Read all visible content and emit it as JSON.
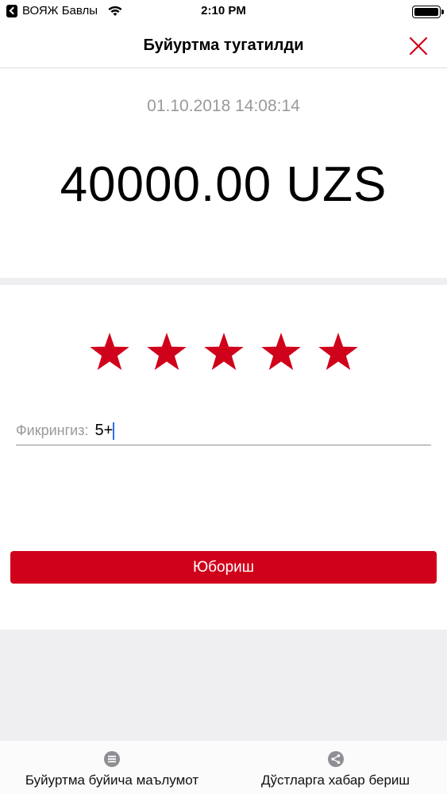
{
  "status_bar": {
    "carrier": "ВОЯЖ Бавлы",
    "time": "2:10 PM"
  },
  "nav": {
    "title": "Буйуртма тугатилди",
    "close_icon": "close-icon"
  },
  "order": {
    "datetime": "01.10.2018 14:08:14",
    "amount": "40000.00 UZS"
  },
  "rating": {
    "value": 5,
    "max": 5,
    "color": "#d0021b"
  },
  "feedback": {
    "label": "Фикрингиз:",
    "value": "5+"
  },
  "send_button": {
    "label": "Юбориш"
  },
  "tabs": [
    {
      "label": "Буйуртма буйича маълумот",
      "icon": "list-icon"
    },
    {
      "label": "Дўстларга хабар бериш",
      "icon": "share-icon"
    }
  ],
  "colors": {
    "accent": "#d0021b",
    "divider": "#efeff1"
  }
}
